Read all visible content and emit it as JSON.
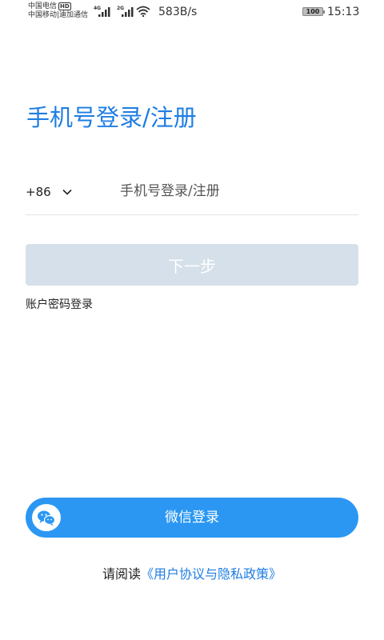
{
  "status_bar": {
    "carrier_1": "中国电信",
    "carrier_1_badge": "HD",
    "carrier_2": "中国移动|迪加通信",
    "signal_1_type": "4G",
    "signal_2_type": "2G",
    "network_speed": "583B/s",
    "battery": "100",
    "time": "15:13"
  },
  "page": {
    "title": "手机号登录/注册"
  },
  "phone_form": {
    "country_code": "+86",
    "phone_placeholder": "手机号登录/注册",
    "phone_value": ""
  },
  "next_button": {
    "label": "下一步"
  },
  "password_login": {
    "label": "账户密码登录"
  },
  "wechat_login": {
    "label": "微信登录",
    "icon": "wechat-icon"
  },
  "agreement": {
    "prefix": "请阅读",
    "link": "《用户协议与隐私政策》"
  },
  "colors": {
    "accent": "#1e7ee3",
    "wechat_button": "#2b97f3",
    "disabled_button": "#d5e0ea"
  }
}
